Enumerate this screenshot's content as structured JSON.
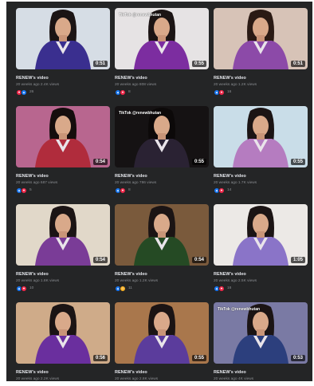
{
  "colors": {
    "like": "#1877f2",
    "love": "#f0284a",
    "care": "#f7b125",
    "frame_bg": "#242526"
  },
  "videos": [
    {
      "title": "RENEW's video",
      "meta": "20 weeks ago 2.4K views",
      "duration": "0:51",
      "reactions": [
        "love",
        "like"
      ],
      "count": "26",
      "watermark": "",
      "bg": "#d6dde5",
      "robe": "#3a2f8f",
      "hair": "#1b1414"
    },
    {
      "title": "RENEW's video",
      "meta": "20 weeks ago 808 views",
      "duration": "0:55",
      "reactions": [
        "like",
        "love"
      ],
      "count": "8",
      "watermark": "TikTok @renewbhutan",
      "bg": "#e6e3e4",
      "robe": "#7c2da0",
      "hair": "#1b1414"
    },
    {
      "title": "RENEW's video",
      "meta": "20 weeks ago 1.2K views",
      "duration": "0:51",
      "reactions": [
        "like",
        "love"
      ],
      "count": "16",
      "watermark": "",
      "bg": "#d7c3b7",
      "robe": "#8c4aa8",
      "hair": "#2a1a14"
    },
    {
      "title": "RENEW's video",
      "meta": "20 weeks ago 687 views",
      "duration": "0:54",
      "reactions": [
        "like",
        "love"
      ],
      "count": "5",
      "watermark": "",
      "bg": "#b8668f",
      "robe": "#b02c3c",
      "hair": "#150d0d"
    },
    {
      "title": "RENEW's video",
      "meta": "20 weeks ago 786 views",
      "duration": "0:55",
      "reactions": [
        "like",
        "love"
      ],
      "count": "8",
      "watermark": "TikTok @renewbhutan",
      "bg": "#151213",
      "robe": "#2a2233",
      "hair": "#0c0909"
    },
    {
      "title": "RENEW's video",
      "meta": "20 weeks ago 1.7K views",
      "duration": "0:55",
      "reactions": [
        "like",
        "love"
      ],
      "count": "14",
      "watermark": "",
      "bg": "#c9dde8",
      "robe": "#b57cc0",
      "hair": "#1b1414"
    },
    {
      "title": "RENEW's video",
      "meta": "20 weeks ago 1.8K views",
      "duration": "0:54",
      "reactions": [
        "like",
        "love"
      ],
      "count": "10",
      "watermark": "",
      "bg": "#e1d8c9",
      "robe": "#7a3c97",
      "hair": "#1b1414"
    },
    {
      "title": "RENEW's video",
      "meta": "20 weeks ago 1.2K views",
      "duration": "0:54",
      "reactions": [
        "like",
        "care"
      ],
      "count": "11",
      "watermark": "",
      "bg": "#7a5a3c",
      "robe": "#254a24",
      "hair": "#1b1414"
    },
    {
      "title": "RENEW's video",
      "meta": "20 weeks ago 2.5K views",
      "duration": "1:05",
      "reactions": [
        "like",
        "love"
      ],
      "count": "16",
      "watermark": "",
      "bg": "#ece9e6",
      "robe": "#8a74c8",
      "hair": "#1b1414"
    },
    {
      "title": "RENEW's video",
      "meta": "20 weeks ago 2.2K views",
      "duration": "0:56",
      "reactions": [
        "like",
        "love"
      ],
      "count": "",
      "watermark": "",
      "bg": "#cfab89",
      "robe": "#6a2f9e",
      "hair": "#1b1414"
    },
    {
      "title": "RENEW's video",
      "meta": "20 weeks ago 2.8K views",
      "duration": "0:55",
      "reactions": [
        "like",
        "love"
      ],
      "count": "",
      "watermark": "",
      "bg": "#a9774c",
      "robe": "#5b3c9c",
      "hair": "#1b1414"
    },
    {
      "title": "RENEW's video",
      "meta": "20 weeks ago 4K views",
      "duration": "0:53",
      "reactions": [
        "like",
        "love"
      ],
      "count": "",
      "watermark": "TikTok @renewbhutan",
      "bg": "#7a7aa4",
      "robe": "#2c3f7d",
      "hair": "#1b1414"
    }
  ]
}
